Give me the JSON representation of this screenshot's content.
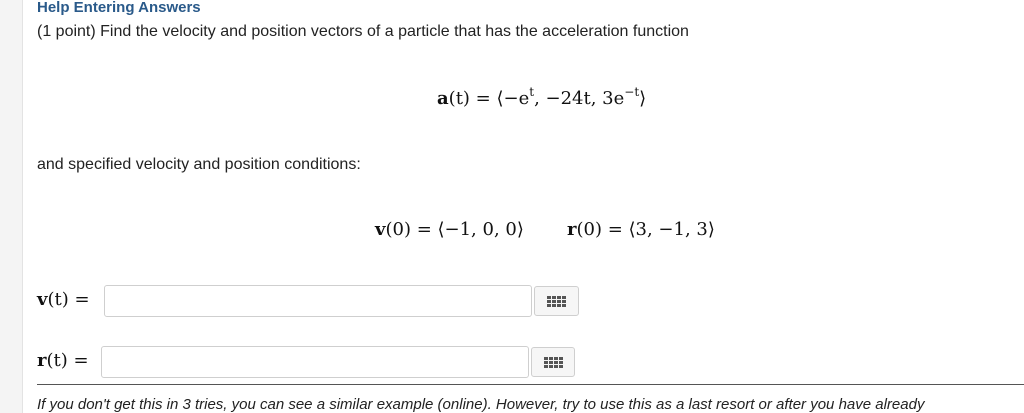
{
  "header": {
    "help_link": "Help Entering Answers",
    "prompt": "(1 point) Find the velocity and position vectors of a particle that has the acceleration function"
  },
  "problem": {
    "acceleration": {
      "name": "a",
      "lhs_rest": "(t) = ⟨−e",
      "exp1": "t",
      "middle": ", −24t, 3e",
      "exp2": "−t",
      "close": "⟩"
    },
    "conditions_text": "and specified velocity and position conditions:",
    "v0": {
      "name": "v",
      "rest": "(0) = ⟨−1, 0, 0⟩"
    },
    "r0": {
      "name": "r",
      "rest": "(0) = ⟨3, −1, 3⟩"
    }
  },
  "answers": {
    "v_label_name": "v",
    "v_label_rest": "(t) =",
    "v_value": "",
    "v_placeholder": "",
    "r_label_name": "r",
    "r_label_rest": "(t) =",
    "r_value": "",
    "r_placeholder": "",
    "palette_icon": "grid-icon"
  },
  "footer": {
    "note": "If you don't get this in 3 tries, you can see a similar example (online). However, try to use this as a last resort or after you have already"
  }
}
